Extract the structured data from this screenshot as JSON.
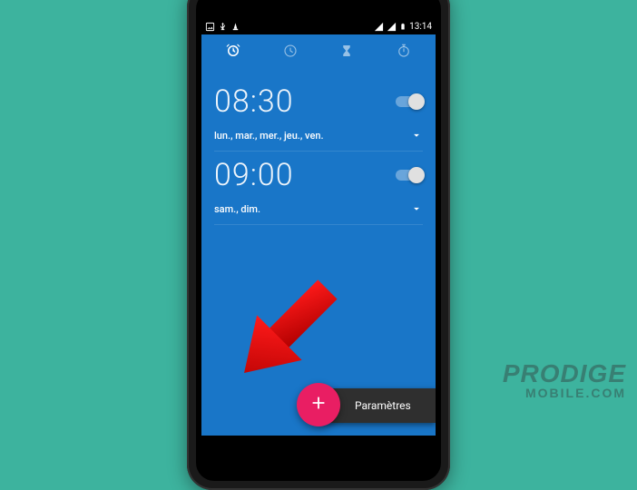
{
  "status_bar": {
    "time": "13:14"
  },
  "tabs": [
    {
      "name": "alarm",
      "active": true
    },
    {
      "name": "clock",
      "active": false
    },
    {
      "name": "timer",
      "active": false
    },
    {
      "name": "stopwatch",
      "active": false
    }
  ],
  "alarms": [
    {
      "time": "08:30",
      "days": "lun., mar., mer., jeu., ven.",
      "enabled": true
    },
    {
      "time": "09:00",
      "days": "sam., dim.",
      "enabled": true
    }
  ],
  "menu": {
    "label": "Paramètres"
  },
  "watermark": {
    "line1": "PRODIGE",
    "line2": "MOBILE.COM"
  },
  "colors": {
    "background": "#3db39e",
    "app_bg": "#1976c8",
    "fab": "#e91e63",
    "arrow": "#d80000"
  }
}
